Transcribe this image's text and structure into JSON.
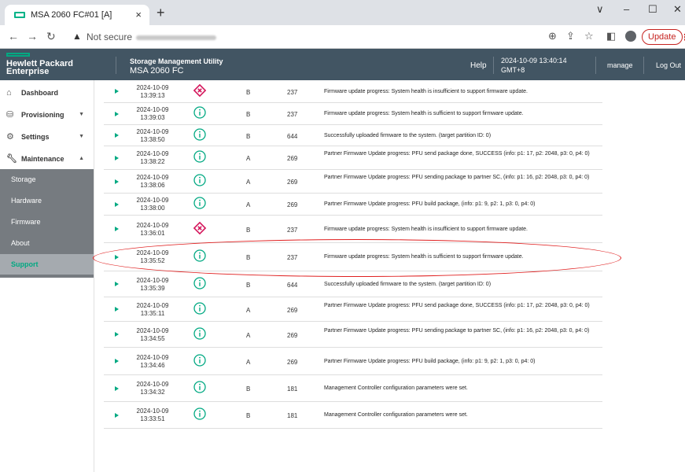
{
  "browser": {
    "tab_title": "MSA 2060 FC#01 [A]",
    "tab_close": "×",
    "new_tab": "+",
    "security_label": "Not secure",
    "update_label": "Update",
    "controls": {
      "minimize": "–",
      "maximize": "☐",
      "close": "✕",
      "tabs_menu": "∨"
    }
  },
  "header": {
    "brand_line1": "Hewlett Packard",
    "brand_line2": "Enterprise",
    "product": "Storage Management Utility",
    "system": "MSA 2060 FC",
    "help": "Help",
    "datetime": "2024-10-09 13:40:14",
    "timezone": "GMT+8",
    "user": "manage",
    "logout": "Log Out"
  },
  "sidebar": {
    "items": [
      {
        "label": "Dashboard",
        "icon": "home-icon"
      },
      {
        "label": "Provisioning",
        "icon": "database-icon"
      },
      {
        "label": "Settings",
        "icon": "gear-icon"
      },
      {
        "label": "Maintenance",
        "icon": "wrench-icon"
      }
    ],
    "subitems": [
      "Storage",
      "Hardware",
      "Firmware",
      "About",
      "Support"
    ],
    "active_subitem": "Support"
  },
  "events": [
    {
      "date": "2024-10-09",
      "time": "13:39:13",
      "severity": "error",
      "controller": "B",
      "code": "237",
      "message": "Firmware update progress: System health is insufficient to support firmware update."
    },
    {
      "date": "2024-10-09",
      "time": "13:39:03",
      "severity": "info",
      "controller": "B",
      "code": "237",
      "message": "Firmware update progress: System health is sufficient to support firmware update."
    },
    {
      "date": "2024-10-09",
      "time": "13:38:50",
      "severity": "info",
      "controller": "B",
      "code": "644",
      "message": "Successfully uploaded firmware to the system. (target partition ID: 0)"
    },
    {
      "date": "2024-10-09",
      "time": "13:38:22",
      "severity": "info",
      "controller": "A",
      "code": "269",
      "message": "Partner Firmware Update progress: PFU send package done, SUCCESS (info: p1: 17, p2: 2048, p3: 0, p4: 0)"
    },
    {
      "date": "2024-10-09",
      "time": "13:38:06",
      "severity": "info",
      "controller": "A",
      "code": "269",
      "message": "Partner Firmware Update progress: PFU sending package to partner SC, (info: p1: 16, p2: 2048, p3: 0, p4: 0)"
    },
    {
      "date": "2024-10-09",
      "time": "13:38:00",
      "severity": "info",
      "controller": "A",
      "code": "269",
      "message": "Partner Firmware Update progress: PFU build package, (info: p1: 9, p2: 1, p3: 0, p4: 0)"
    },
    {
      "date": "2024-10-09",
      "time": "13:36:01",
      "severity": "error",
      "controller": "B",
      "code": "237",
      "message": "Firmware update progress: System health is insufficient to support firmware update."
    },
    {
      "date": "2024-10-09",
      "time": "13:35:52",
      "severity": "info",
      "controller": "B",
      "code": "237",
      "message": "Firmware update progress: System health is sufficient to support firmware update."
    },
    {
      "date": "2024-10-09",
      "time": "13:35:39",
      "severity": "info",
      "controller": "B",
      "code": "644",
      "message": "Successfully uploaded firmware to the system. (target partition ID: 0)"
    },
    {
      "date": "2024-10-09",
      "time": "13:35:11",
      "severity": "info",
      "controller": "A",
      "code": "269",
      "message": "Partner Firmware Update progress: PFU send package done, SUCCESS (info: p1: 17, p2: 2048, p3: 0, p4: 0)"
    },
    {
      "date": "2024-10-09",
      "time": "13:34:55",
      "severity": "info",
      "controller": "A",
      "code": "269",
      "message": "Partner Firmware Update progress: PFU sending package to partner SC, (info: p1: 16, p2: 2048, p3: 0, p4: 0)"
    },
    {
      "date": "2024-10-09",
      "time": "13:34:46",
      "severity": "info",
      "controller": "A",
      "code": "269",
      "message": "Partner Firmware Update progress: PFU build package, (info: p1: 9, p2: 1, p3: 0, p4: 0)"
    },
    {
      "date": "2024-10-09",
      "time": "13:34:32",
      "severity": "info",
      "controller": "B",
      "code": "181",
      "message": "Management Controller configuration parameters were set."
    },
    {
      "date": "2024-10-09",
      "time": "13:33:51",
      "severity": "info",
      "controller": "B",
      "code": "181",
      "message": "Management Controller configuration parameters were set."
    }
  ],
  "colors": {
    "accent": "#01a982",
    "header_bg": "#425563",
    "error": "#d4145a",
    "info": "#01a982",
    "annotation": "#e02020"
  }
}
